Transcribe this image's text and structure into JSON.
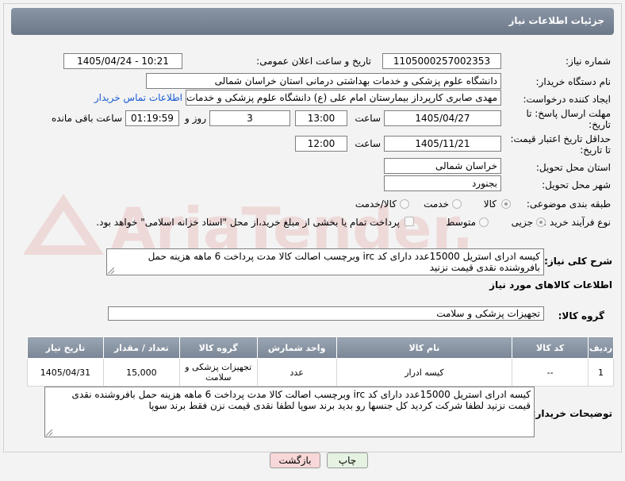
{
  "header": {
    "title": "جزئیات اطلاعات نیاز"
  },
  "fields": {
    "need_number_label": "شماره نیاز:",
    "need_number": "1105000257002353",
    "announce_label": "تاریخ و ساعت اعلان عمومی:",
    "announce_value": "1405/04/24 - 10:21",
    "buyer_org_label": "نام دستگاه خریدار:",
    "buyer_org": "دانشگاه علوم پزشکی و خدمات بهداشتی درمانی استان خراسان شمالی",
    "requester_label": "ایجاد کننده درخواست:",
    "requester": "مهدی صابری کارپرداز بیمارستان امام علی (ع) دانشگاه علوم پزشکی و خدمات بهداشتی درمانی",
    "contact_link": "اطلاعات تماس خریدار",
    "reply_deadline_label_1": "مهلت ارسال پاسخ: تا",
    "reply_deadline_label_2": "تاریخ:",
    "reply_date": "1405/04/27",
    "time_label": "ساعت",
    "reply_time": "13:00",
    "days_value": "3",
    "days_label": "روز و",
    "remaining_time": "01:19:59",
    "remaining_label": "ساعت باقی مانده",
    "price_validity_label_1": "حداقل تاریخ اعتبار قیمت:",
    "price_validity_label_2": "تا تاریخ:",
    "price_date": "1405/11/21",
    "price_time_label": "ساعت",
    "price_time": "12:00",
    "province_label": "استان محل تحویل:",
    "province": "خراسان شمالی",
    "city_label": "شهر محل تحویل:",
    "city": "بجنورد",
    "category_label": "طبقه بندی موضوعی:",
    "category_options": [
      "کالا",
      "خدمت",
      "کالا/خدمت"
    ],
    "category_selected": "کالا",
    "process_label": "نوع فرآیند خرید :",
    "process_options": [
      "جزیی",
      "متوسط"
    ],
    "process_selected": "جزیی",
    "payment_note": "پرداخت تمام یا بخشی از مبلغ خرید،از محل \"اسناد خزانه اسلامی\" خواهد بود."
  },
  "description": {
    "label": "شرح کلی نیاز:",
    "text": "کیسه ادرای استریل 15000عدد دارای کد irc وبرچسب اصالت کالا مدت پرداخت 6 ماهه هزینه حمل بافروشنده نقدی قیمت نزنید"
  },
  "goods_info": {
    "section_title": "اطلاعات کالاهای مورد نیاز",
    "group_label": "گروه کالا:",
    "group_value": "تجهیزات پزشکی و سلامت"
  },
  "table": {
    "headers": [
      "ردیف",
      "کد کالا",
      "نام کالا",
      "واحد شمارش",
      "گروه کالا",
      "تعداد / مقدار",
      "تاریخ نیاز"
    ],
    "rows": [
      [
        "1",
        "--",
        "کیسه ادرار",
        "عدد",
        "تجهیزات پزشکی و سلامت",
        "15,000",
        "1405/04/31"
      ]
    ]
  },
  "buyer_notes": {
    "label": "توضیحات خریدار:",
    "text": "کیسه ادرای استریل 15000عدد دارای کد irc وبرچسب اصالت کالا مدت پرداخت 6 ماهه هزینه حمل بافروشنده نقدی قیمت نزنید لطفا  شرکت کردید کل  جنسها رو بدید  برند سوپا لطفا   نقدی قیمت نزن فقط برند سوپا"
  },
  "buttons": {
    "print": "چاپ",
    "back": "بازگشت"
  },
  "watermark_text": "AriaTender.net",
  "colors": {
    "header": "#7a8696",
    "link": "#1a5bd6",
    "back_button": "#f7d7d7",
    "print_button": "#e6f2e1"
  }
}
